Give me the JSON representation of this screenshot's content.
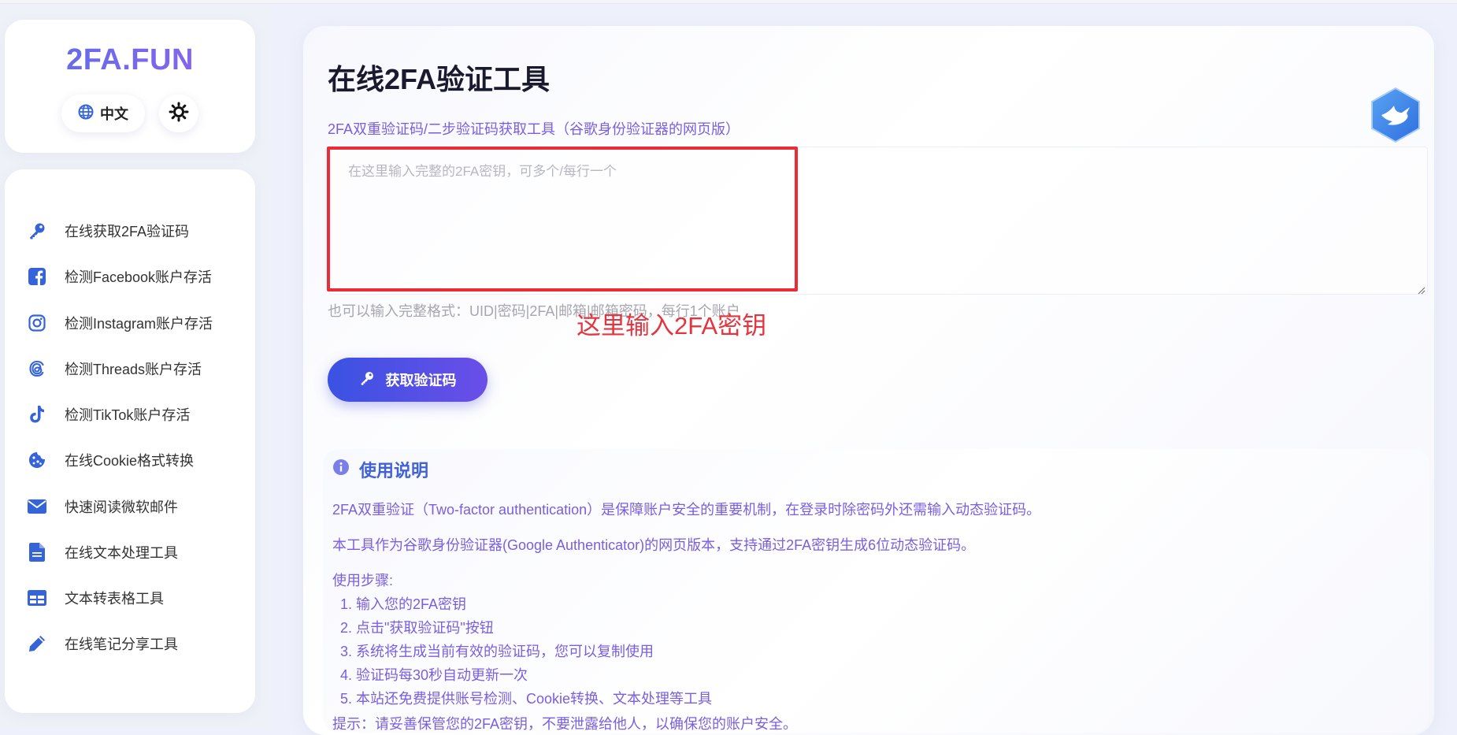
{
  "sidebar": {
    "brand": "2FA.FUN",
    "language_label": "中文",
    "items": [
      {
        "label": "在线获取2FA验证码",
        "icon": "key-icon"
      },
      {
        "label": "检测Facebook账户存活",
        "icon": "facebook-icon"
      },
      {
        "label": "检测Instagram账户存活",
        "icon": "instagram-icon"
      },
      {
        "label": "检测Threads账户存活",
        "icon": "threads-icon"
      },
      {
        "label": "检测TikTok账户存活",
        "icon": "tiktok-icon"
      },
      {
        "label": "在线Cookie格式转换",
        "icon": "cookie-icon"
      },
      {
        "label": "快速阅读微软邮件",
        "icon": "envelope-icon"
      },
      {
        "label": "在线文本处理工具",
        "icon": "file-icon"
      },
      {
        "label": "文本转表格工具",
        "icon": "table-icon"
      },
      {
        "label": "在线笔记分享工具",
        "icon": "pencil-icon"
      }
    ]
  },
  "main": {
    "title": "在线2FA验证工具",
    "subtitle": "2FA双重验证码/二步验证码获取工具（谷歌身份验证器的网页版）",
    "textarea_placeholder": "在这里输入完整的2FA密钥，可多个/每行一个",
    "hint": "也可以输入完整格式：UID|密码|2FA|邮箱|邮箱密码，每行1个账户",
    "annotation": "这里输入2FA密钥",
    "get_button_label": "获取验证码"
  },
  "info": {
    "title": "使用说明",
    "para1": "2FA双重验证（Two-factor authentication）是保障账户安全的重要机制，在登录时除密码外还需输入动态验证码。",
    "para2": "本工具作为谷歌身份验证器(Google Authenticator)的网页版本，支持通过2FA密钥生成6位动态验证码。",
    "steps_label": "使用步骤:",
    "steps": [
      "1. 输入您的2FA密钥",
      "2. 点击\"获取验证码\"按钮",
      "3. 系统将生成当前有效的验证码，您可以复制使用",
      "4. 验证码每30秒自动更新一次",
      "5. 本站还免费提供账号检测、Cookie转换、文本处理等工具"
    ],
    "tip": "提示：请妥善保管您的2FA密钥，不要泄露给他人，以确保您的账户安全。"
  },
  "colors": {
    "accent": "#3a52e2",
    "accent_purple": "#7a5ee0",
    "annotation_red": "#e5343e",
    "info_blue": "#4161d9"
  }
}
